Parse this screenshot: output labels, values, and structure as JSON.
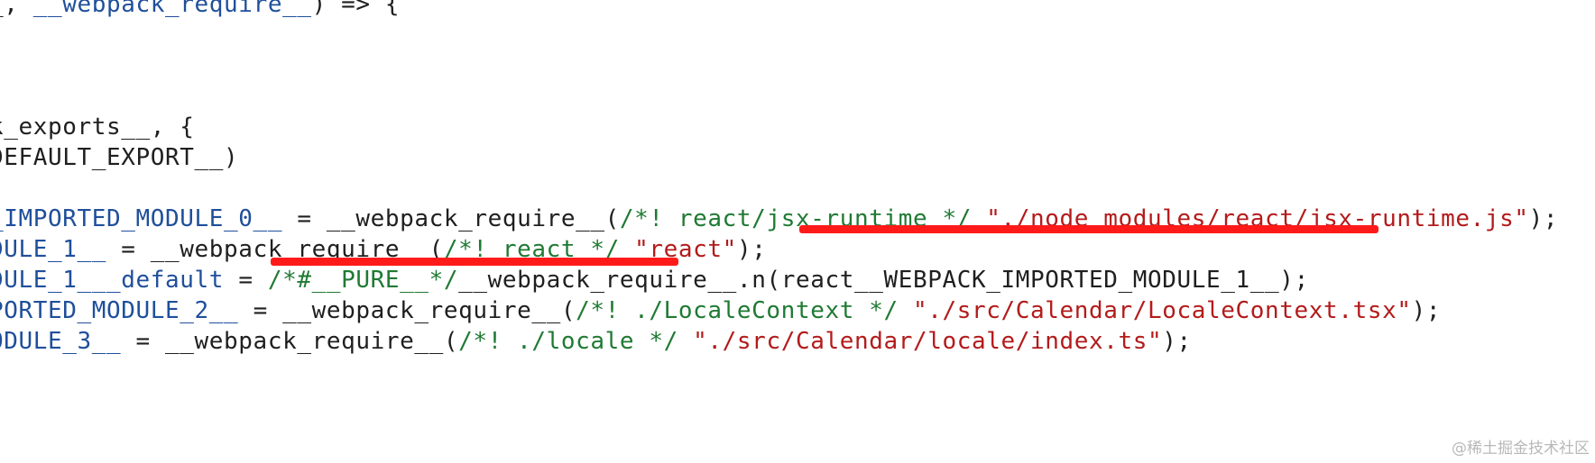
{
  "code": {
    "lines": [
      [
        {
          "t": "_, ",
          "c": "d"
        },
        {
          "t": "__webpack_require__",
          "c": "b"
        },
        {
          "t": ") => {",
          "c": "d"
        }
      ],
      [],
      [],
      [],
      [
        {
          "t": "k_exports__, {",
          "c": "d"
        }
      ],
      [
        {
          "t": "DEFAULT_EXPORT__)",
          "c": "d"
        }
      ],
      [],
      [
        {
          "t": "_IMPORTED_MODULE_0__",
          "c": "b"
        },
        {
          "t": " = __webpack_require__(",
          "c": "d"
        },
        {
          "t": "/*! react/jsx-runtime */ ",
          "c": "g"
        },
        {
          "t": "\"./node_modules/react/jsx-runtime.js\"",
          "c": "r"
        },
        {
          "t": ");",
          "c": "d"
        }
      ],
      [
        {
          "t": "DULE_1__",
          "c": "b"
        },
        {
          "t": " = __webpack_require__(",
          "c": "d"
        },
        {
          "t": "/*! react */ ",
          "c": "g"
        },
        {
          "t": "\"react\"",
          "c": "r"
        },
        {
          "t": ");",
          "c": "d"
        }
      ],
      [
        {
          "t": "DULE_1___default",
          "c": "b"
        },
        {
          "t": " = ",
          "c": "d"
        },
        {
          "t": "/*#__PURE__*/",
          "c": "g"
        },
        {
          "t": "__webpack_require__.n(react__WEBPACK_IMPORTED_MODULE_1__);",
          "c": "d"
        }
      ],
      [
        {
          "t": "PORTED_MODULE_2__",
          "c": "b"
        },
        {
          "t": " = __webpack_require__(",
          "c": "d"
        },
        {
          "t": "/*! ./LocaleContext */ ",
          "c": "g"
        },
        {
          "t": "\"./src/Calendar/LocaleContext.tsx\"",
          "c": "r"
        },
        {
          "t": ");",
          "c": "d"
        }
      ],
      [
        {
          "t": "ODULE_3__",
          "c": "b"
        },
        {
          "t": " = __webpack_require__(",
          "c": "d"
        },
        {
          "t": "/*! ./locale */ ",
          "c": "g"
        },
        {
          "t": "\"./src/Calendar/locale/index.ts\"",
          "c": "r"
        },
        {
          "t": ");",
          "c": "d"
        }
      ]
    ]
  },
  "annotations": [
    {
      "name": "highlight-jsx-runtime-import",
      "line": 7
    },
    {
      "name": "highlight-react-import",
      "line": 8
    }
  ],
  "watermark": "@稀土掘金技术社区",
  "colors": {
    "identifier": "#1f4f9b",
    "default": "#1f1f1f",
    "comment": "#1f7a33",
    "string": "#b31b1b",
    "annotation": "#ff1a1a",
    "watermark": "#b8b8b8",
    "background": "#ffffff"
  }
}
